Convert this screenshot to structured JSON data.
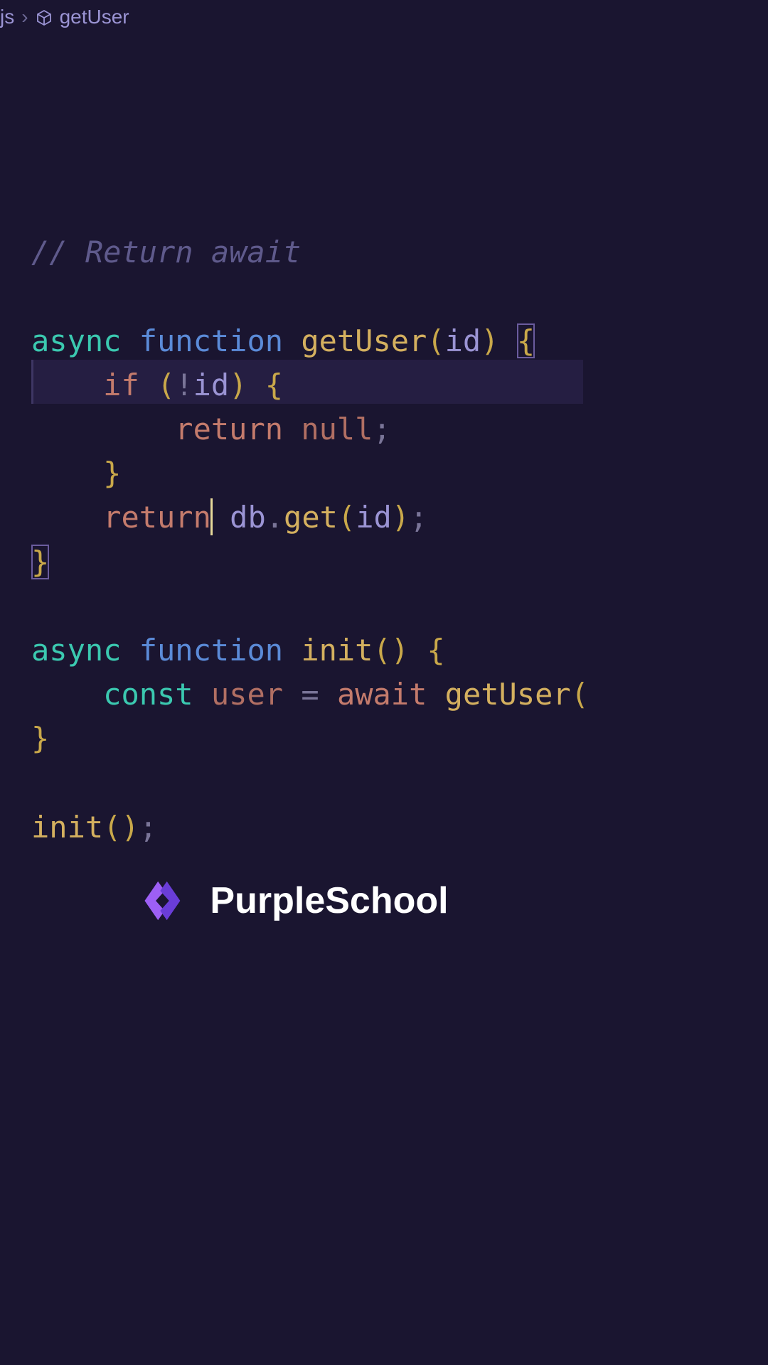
{
  "breadcrumb": {
    "file": "js",
    "symbol": "getUser"
  },
  "code": {
    "comment": "// Return await",
    "line3_async": "async",
    "line3_function": "function",
    "line3_name": "getUser",
    "line3_param": "id",
    "line4_if": "if",
    "line4_param": "id",
    "line5_return": "return",
    "line5_null": "null",
    "line7_return": "return",
    "line7_obj": "db",
    "line7_method": "get",
    "line7_arg": "id",
    "line10_async": "async",
    "line10_function": "function",
    "line10_name": "init",
    "line11_const": "const",
    "line11_var": "user",
    "line11_await": "await",
    "line11_call": "getUser",
    "line14_call": "init"
  },
  "brand": {
    "name": "PurpleSchool"
  }
}
